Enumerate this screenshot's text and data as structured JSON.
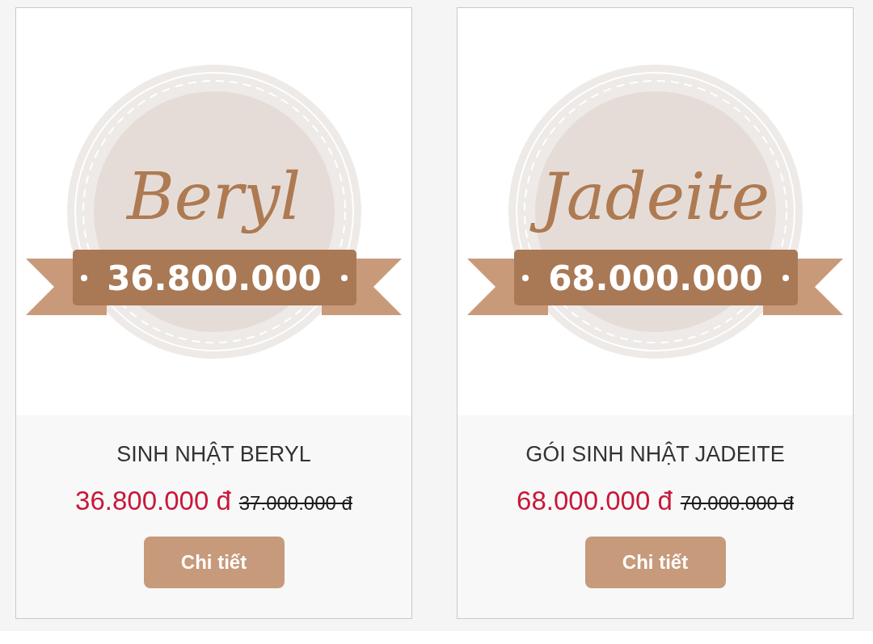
{
  "products": [
    {
      "image": {
        "script_name": "Beryl",
        "ribbon_price": "36.800.000"
      },
      "title": "SINH NHẬT BERYL",
      "price": "36.800.000 đ",
      "old_price": "37.000.000 đ",
      "button": "Chi tiết"
    },
    {
      "image": {
        "script_name": "Jadeite",
        "ribbon_price": "68.000.000"
      },
      "title": "GÓI SINH NHẬT JADEITE",
      "price": "68.000.000 đ",
      "old_price": "70.000.000 đ",
      "button": "Chi tiết"
    }
  ]
}
